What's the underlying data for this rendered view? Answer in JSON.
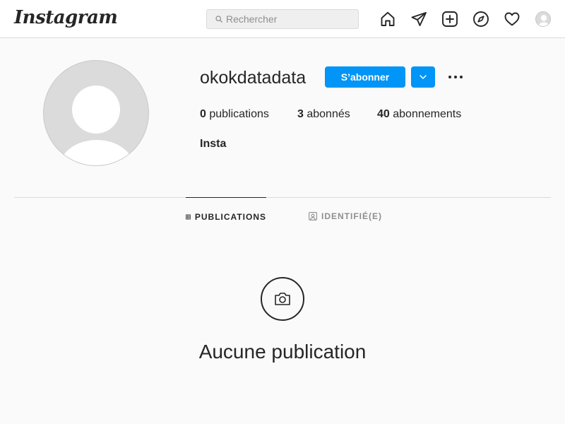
{
  "header": {
    "logo_text": "Instagram",
    "search_placeholder": "Rechercher"
  },
  "nav": {
    "icons": [
      "home-icon",
      "direct-icon",
      "new-post-icon",
      "explore-icon",
      "activity-icon",
      "profile-avatar"
    ]
  },
  "profile": {
    "username": "okokdatadata",
    "follow_label": "S’abonner",
    "stats": {
      "posts_count": "0",
      "posts_label": "publications",
      "followers_count": "3",
      "followers_label": "abonnés",
      "following_count": "40",
      "following_label": "abonnements"
    },
    "full_name": "Insta"
  },
  "tabs": [
    {
      "label": "PUBLICATIONS",
      "icon": "grid-icon",
      "active": true
    },
    {
      "label": "IDENTIFIÉ(E)",
      "icon": "tagged-icon",
      "active": false
    }
  ],
  "empty_state": {
    "icon": "camera-icon",
    "message": "Aucune publication"
  },
  "colors": {
    "accent": "#0095f6",
    "background": "#fafafa",
    "text": "#262626",
    "muted": "#8e8e8e",
    "border": "#dbdbdb"
  }
}
